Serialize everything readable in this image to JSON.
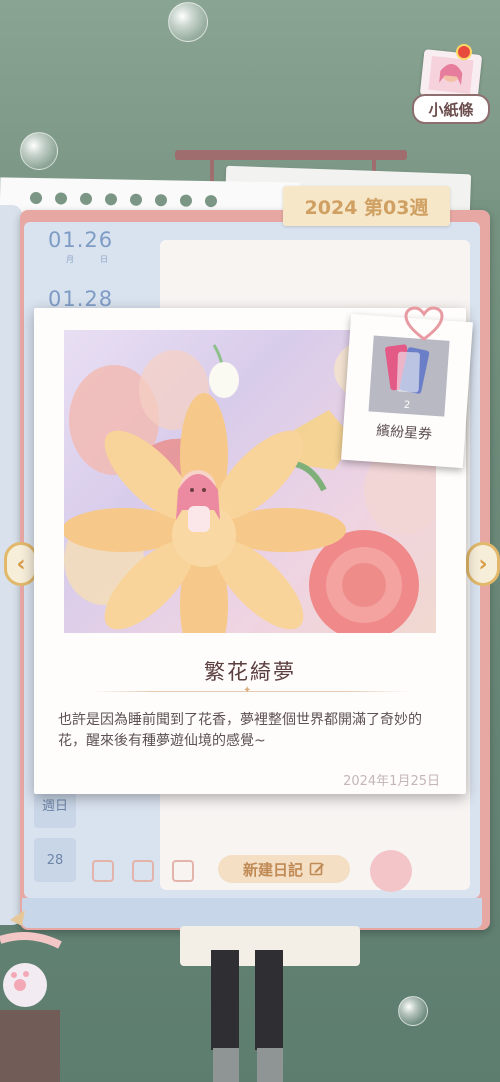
{
  "header": {
    "week_label": "2024 第03週",
    "note_button_label": "小紙條"
  },
  "diary": {
    "dates": [
      {
        "date": "01.26",
        "month": "月",
        "day": "日"
      },
      {
        "date": "01.28"
      }
    ],
    "side_label_week": "週日",
    "side_label_day": "28",
    "new_diary_label": "新建日記"
  },
  "card": {
    "title": "繁花綺夢",
    "text": "也許是因為睡前聞到了花香，夢裡整個世界都開滿了奇妙的花，醒來後有種夢遊仙境的感覺~",
    "date": "2024年1月25日"
  },
  "reward": {
    "name": "繽紛星券",
    "quantity": "2"
  },
  "nav": {
    "prev": "‹",
    "next": "›"
  },
  "colors": {
    "book_frame": "#e7a8a4",
    "accent_gold": "#e2b86a",
    "title_text": "#5b3e3e"
  }
}
